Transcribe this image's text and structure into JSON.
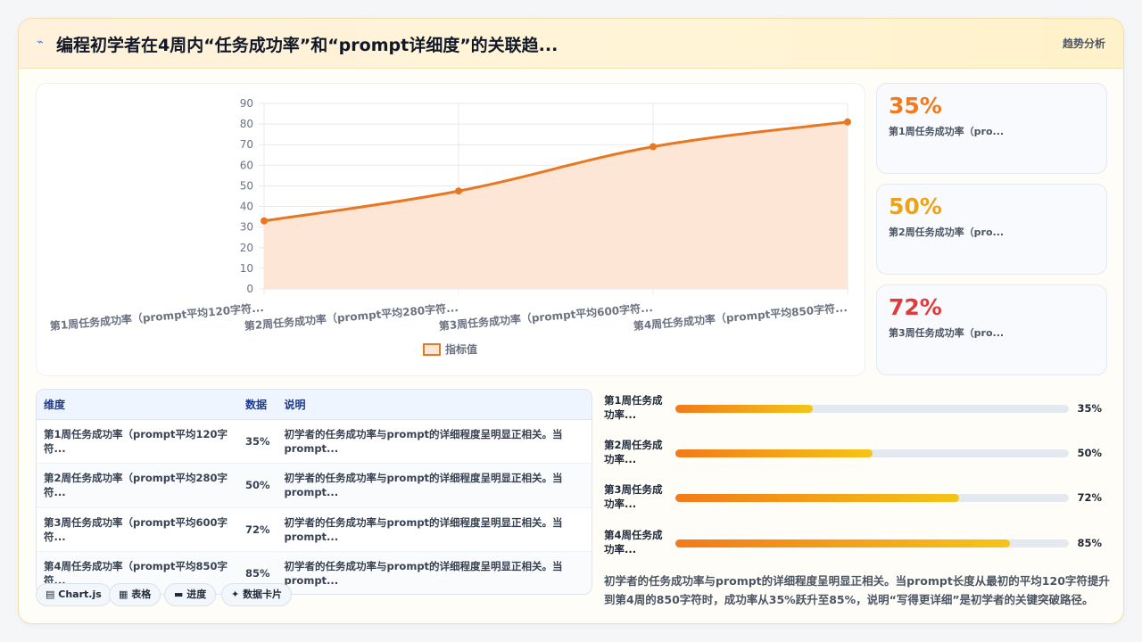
{
  "header": {
    "icon": "trend-icon",
    "title": "编程初学者在4周内“任务成功率”和“prompt详细度”的关联趋...",
    "right_label": "趋势分析"
  },
  "colors": {
    "line": "#e87722",
    "area": "#fde6d6",
    "kpi_1": "#ef7a1f",
    "kpi_2": "#eba417",
    "kpi_3": "#e03b3b",
    "bar_gradient": [
      "#f27a1a",
      "#f5c518"
    ]
  },
  "chart_data": {
    "type": "line",
    "categories": [
      "第1周任务成功率（prompt平均120字符...",
      "第2周任务成功率（prompt平均280字符...",
      "第3周任务成功率（prompt平均600字符...",
      "第4周任务成功率（prompt平均850字符..."
    ],
    "series": [
      {
        "name": "指标值",
        "values": [
          33,
          47.5,
          69,
          81
        ]
      }
    ],
    "ylim": [
      0,
      90
    ],
    "yticks": [
      0,
      10,
      20,
      30,
      40,
      50,
      60,
      70,
      80,
      90
    ],
    "grid": true,
    "area_fill": true,
    "legend_position": "bottom"
  },
  "kpis": [
    {
      "value": "35%",
      "label": "第1周任务成功率（pro..."
    },
    {
      "value": "50%",
      "label": "第2周任务成功率（pro..."
    },
    {
      "value": "72%",
      "label": "第3周任务成功率（pro..."
    }
  ],
  "table": {
    "headers": [
      "维度",
      "数据",
      "说明"
    ],
    "rows": [
      {
        "dim": "第1周任务成功率（prompt平均120字符...",
        "num": "35%",
        "desc": "初学者的任务成功率与prompt的详细程度呈明显正相关。当prompt..."
      },
      {
        "dim": "第2周任务成功率（prompt平均280字符...",
        "num": "50%",
        "desc": "初学者的任务成功率与prompt的详细程度呈明显正相关。当prompt..."
      },
      {
        "dim": "第3周任务成功率（prompt平均600字符...",
        "num": "72%",
        "desc": "初学者的任务成功率与prompt的详细程度呈明显正相关。当prompt..."
      },
      {
        "dim": "第4周任务成功率（prompt平均850字符...",
        "num": "85%",
        "desc": "初学者的任务成功率与prompt的详细程度呈明显正相关。当prompt..."
      }
    ]
  },
  "tags": [
    {
      "icon": "chart-icon",
      "glyph": "▤",
      "label": "Chart.js"
    },
    {
      "icon": "table-icon",
      "glyph": "▦",
      "label": "表格"
    },
    {
      "icon": "progress-icon",
      "glyph": "▬",
      "label": "进度"
    },
    {
      "icon": "card-icon",
      "glyph": "✦",
      "label": "数据卡片"
    }
  ],
  "progress": [
    {
      "label": "第1周任务成功率...",
      "value": 0.35,
      "value_text": "35%"
    },
    {
      "label": "第2周任务成功率...",
      "value": 0.5,
      "value_text": "50%"
    },
    {
      "label": "第3周任务成功率...",
      "value": 0.72,
      "value_text": "72%"
    },
    {
      "label": "第4周任务成功率...",
      "value": 0.85,
      "value_text": "85%"
    }
  ],
  "summary": "初学者的任务成功率与prompt的详细程度呈明显正相关。当prompt长度从最初的平均120字符提升到第4周的850字符时，成功率从35%跃升至85%，说明“写得更详细”是初学者的关键突破路径。"
}
